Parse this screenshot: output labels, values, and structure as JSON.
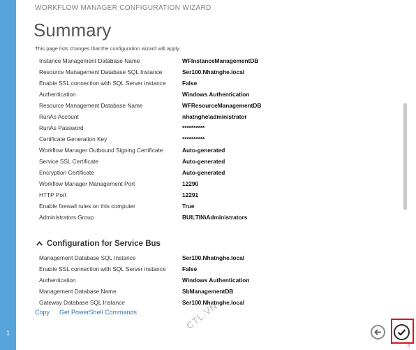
{
  "wizard": {
    "title": "WORKFLOW MANAGER CONFIGURATION WIZARD",
    "page_title": "Summary",
    "subtitle": "This page lists changes that the configuration wizard will apply.",
    "step_number": "1"
  },
  "summary_rows": [
    {
      "key": "Instance Management Database Name",
      "value": "WFInstanceManagementDB"
    },
    {
      "key": "Resource Management Database SQL Instance",
      "value": "Ser100.Nhatnghe.local"
    },
    {
      "key": "Enable SSL connection with SQL Server instance",
      "value": "False"
    },
    {
      "key": "Authentication",
      "value": "Windows Authentication"
    },
    {
      "key": "Resource Management Database Name",
      "value": "WFResourceManagementDB"
    },
    {
      "key": "RunAs Account",
      "value": "nhatnghe\\administrator"
    },
    {
      "key": "RunAs Password",
      "value": "**********"
    },
    {
      "key": "Certificate Generation Key",
      "value": "**********"
    },
    {
      "key": "Workflow Manager Outbound Signing Certificate",
      "value": "Auto-generated"
    },
    {
      "key": "Service SSL Certificate",
      "value": "Auto-generated"
    },
    {
      "key": "Encryption Certificate",
      "value": "Auto-generated"
    },
    {
      "key": "Workflow Manager Management Port",
      "value": "12290"
    },
    {
      "key": "HTTP Port",
      "value": "12291"
    },
    {
      "key": "Enable firewall rules on this computer",
      "value": "True"
    },
    {
      "key": "Administrators Group",
      "value": "BUILTIN\\Administrators"
    }
  ],
  "service_bus_section": {
    "title": "Configuration for Service Bus",
    "rows": [
      {
        "key": "Management Database SQL Instance",
        "value": "Ser100.Nhatnghe.local"
      },
      {
        "key": "Enable SSL connection with SQL Server instance",
        "value": "False"
      },
      {
        "key": "Authentication",
        "value": "Windows Authentication"
      },
      {
        "key": "Management Database Name",
        "value": "SbManagementDB"
      },
      {
        "key": "Gateway Database SQL Instance",
        "value": "Ser100.Nhatnghe.local"
      }
    ]
  },
  "links": {
    "copy": "Copy",
    "powershell": "Get PowerShell Commands"
  },
  "watermark": "CTL.VN",
  "corner_mark": "//",
  "icons": {
    "back": "arrow-left-circle-icon",
    "finish": "checkmark-circle-icon",
    "collapse": "chevron-up-icon"
  },
  "colors": {
    "side_band": "#57a3dc",
    "link": "#3575b5",
    "highlight": "#d9141e"
  }
}
